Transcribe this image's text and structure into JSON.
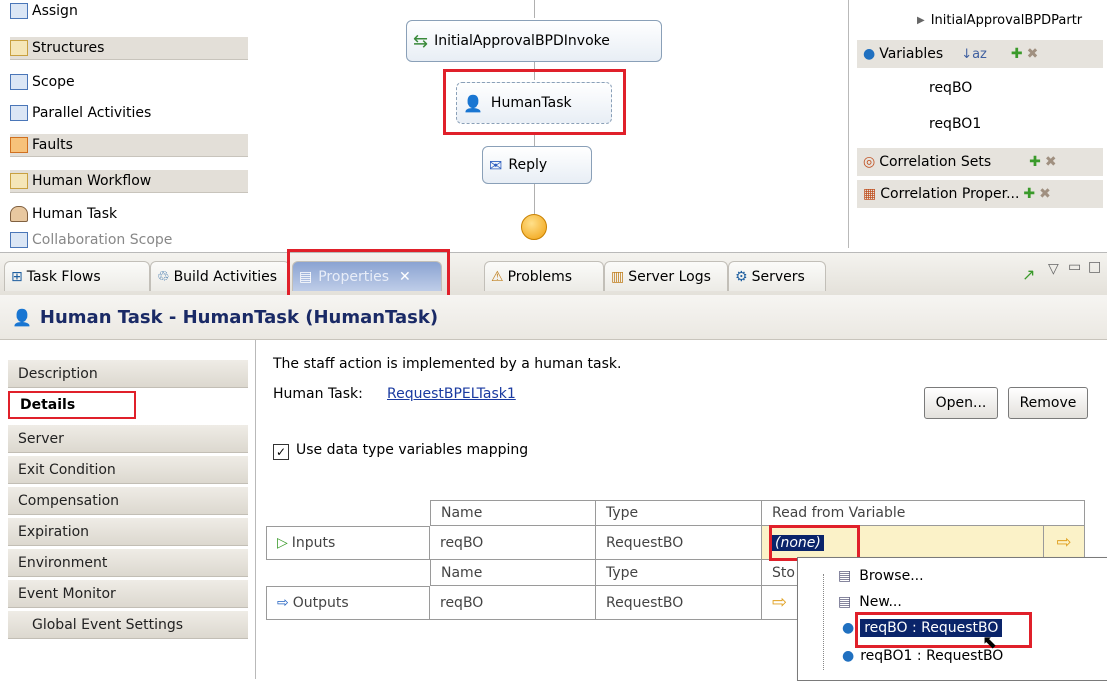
{
  "palette": {
    "items": [
      {
        "label": "Assign",
        "drawer": false
      },
      {
        "label": "Structures",
        "drawer": true
      },
      {
        "label": "Scope",
        "drawer": false
      },
      {
        "label": "Parallel Activities",
        "drawer": false
      },
      {
        "label": "Faults",
        "drawer": true
      },
      {
        "label": "Human Workflow",
        "drawer": true
      },
      {
        "label": "Human Task",
        "drawer": false
      },
      {
        "label": "Collaboration Scope",
        "drawer": false
      }
    ]
  },
  "canvas": {
    "invoke_label": "InitialApprovalBPDInvoke",
    "human_task_label": "HumanTask",
    "reply_label": "Reply"
  },
  "outline": {
    "partner_label": "InitialApprovalBPDPartr",
    "variables_label": "Variables",
    "var1": "reqBO",
    "var2": "reqBO1",
    "correlation_sets": "Correlation Sets",
    "correlation_props": "Correlation Proper..."
  },
  "tabs": [
    {
      "label": "Task Flows"
    },
    {
      "label": "Build Activities"
    },
    {
      "label": "Properties"
    },
    {
      "label": "Problems"
    },
    {
      "label": "Server Logs"
    },
    {
      "label": "Servers"
    }
  ],
  "header": {
    "title": "Human Task - HumanTask (HumanTask)"
  },
  "nav": [
    "Description",
    "Details",
    "Server",
    "Exit Condition",
    "Compensation",
    "Expiration",
    "Environment",
    "Event Monitor",
    "Global Event Settings"
  ],
  "details": {
    "info_text": "The staff action is implemented by a human task.",
    "human_task_label": "Human Task:",
    "human_task_link": "RequestBPELTask1",
    "open_button": "Open...",
    "remove_button": "Remove",
    "checkbox_label": "Use data type variables mapping",
    "table": {
      "col_name": "Name",
      "col_type": "Type",
      "col_read": "Read from Variable",
      "inputs_label": "Inputs",
      "inputs_name": "reqBO",
      "inputs_type": "RequestBO",
      "inputs_value": "(none)",
      "col_name2": "Name",
      "col_type2": "Type",
      "col_store": "Sto",
      "outputs_label": "Outputs",
      "outputs_name": "reqBO",
      "outputs_type": "RequestBO"
    }
  },
  "dropdown": {
    "items": [
      "Browse...",
      "New...",
      "reqBO : RequestBO",
      "reqBO1 : RequestBO"
    ]
  },
  "colors": {
    "highlight": "#e0202a",
    "selection": "#0a246a"
  }
}
